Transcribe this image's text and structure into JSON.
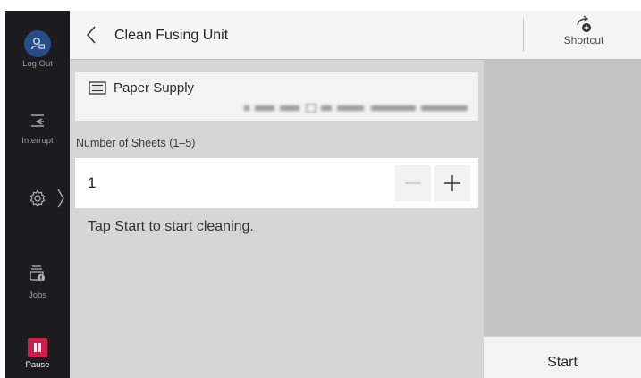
{
  "sidebar": {
    "logout_label": "Log Out",
    "interrupt_label": "Interrupt",
    "jobs_label": "Jobs",
    "pause_label": "Pause"
  },
  "header": {
    "title": "Clean Fusing Unit",
    "shortcut_label": "Shortcut"
  },
  "paper_supply": {
    "label": "Paper Supply"
  },
  "sheets": {
    "label": "Number of Sheets (1–5)",
    "value": "1"
  },
  "hint": "Tap Start to start cleaning.",
  "start_label": "Start",
  "colors": {
    "rail_bg": "#1c1c1e",
    "avatar_bg": "#284d86",
    "pause_bg": "#cf1e4b",
    "main_bg": "#d6d6d4",
    "right_pane_bg": "#c4c4c2"
  }
}
